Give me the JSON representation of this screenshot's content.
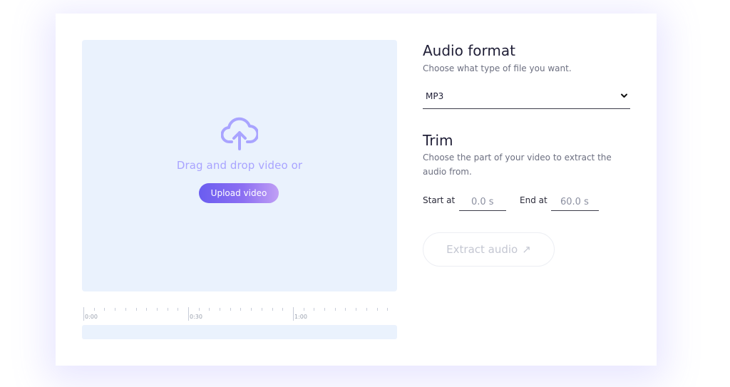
{
  "dropzone": {
    "prompt": "Drag and drop video or",
    "upload_label": "Upload video",
    "icon": "cloud-upload-icon"
  },
  "timeline": {
    "labels": [
      "0:00",
      "0:30",
      "1:00"
    ]
  },
  "audio_format": {
    "title": "Audio format",
    "subtitle": "Choose what type of file you want.",
    "selected": "MP3"
  },
  "trim": {
    "title": "Trim",
    "subtitle_line1": "Choose the part of your video to extract the",
    "subtitle_line2": "audio from.",
    "start_label": "Start at",
    "start_value": "0.0 s",
    "end_label": "End at",
    "end_value": "60.0 s"
  },
  "actions": {
    "extract_label": "Extract audio",
    "extract_arrow": "↗"
  },
  "colors": {
    "accent": "#6a5df0",
    "dropzone_bg": "#eaf2fd",
    "prompt_text": "#a9a4ff"
  }
}
